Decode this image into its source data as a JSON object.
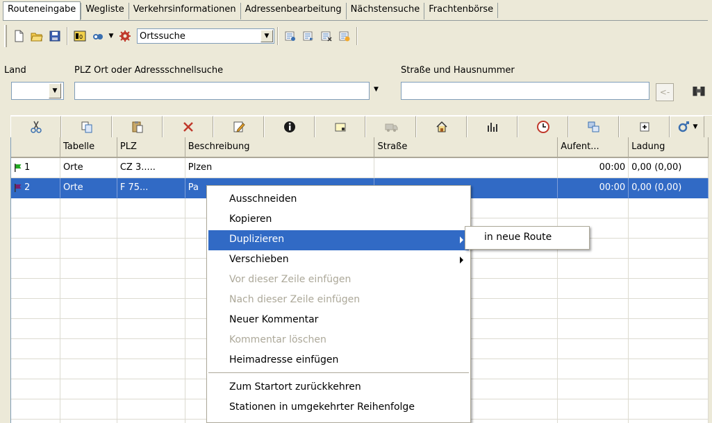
{
  "tabs": [
    "Routeneingabe",
    "Wegliste",
    "Verkehrsinformationen",
    "Adressenbearbeitung",
    "Nächstensuche",
    "Frachtenbörse"
  ],
  "toolbar": {
    "search_mode_value": "Ortssuche",
    "icons": [
      "new-document-icon",
      "open-folder-icon",
      "save-icon",
      "info-panel-icon",
      "binoculars-icon",
      "settings-gear-icon",
      "route-icon-1",
      "route-icon-2",
      "route-icon-3",
      "route-icon-4"
    ]
  },
  "address": {
    "land_label": "Land",
    "plz_label": "PLZ Ort oder Adressschnellsuche",
    "street_label": "Straße und Hausnummer",
    "land_value": "",
    "plz_value": "",
    "street_value": "",
    "back_button": "<-"
  },
  "grid_toolbar": {
    "icons": [
      "cut-icon",
      "copy-icon",
      "paste-icon",
      "delete-icon",
      "edit-icon",
      "info-icon",
      "note-icon",
      "truck-icon",
      "home-icon",
      "chart-icon",
      "clock-icon",
      "swap-icon",
      "add-icon",
      "gender-icon"
    ]
  },
  "grid": {
    "headers": [
      "",
      "Tabelle",
      "PLZ",
      "Beschreibung",
      "Straße",
      "Aufent...",
      "Ladung"
    ],
    "rows": [
      {
        "num": "1",
        "flag_color": "#22aa22",
        "tabelle": "Orte",
        "plz": "CZ 3.....",
        "beschreibung": "Plzen",
        "strasse": "",
        "aufent": "00:00",
        "ladung": "0,00 (0,00)"
      },
      {
        "num": "2",
        "flag_color": "#7a1f6e",
        "tabelle": "Orte",
        "plz": "F 75...",
        "beschreibung": "Pa",
        "strasse": "",
        "aufent": "00:00",
        "ladung": "0,00 (0,00)"
      }
    ]
  },
  "context_menu": {
    "items": [
      {
        "label": "Ausschneiden",
        "state": "normal"
      },
      {
        "label": "Kopieren",
        "state": "normal"
      },
      {
        "label": "Duplizieren",
        "state": "highlighted",
        "submenu": true
      },
      {
        "label": "Verschieben",
        "state": "normal",
        "submenu": true
      },
      {
        "label": "Vor dieser Zeile einfügen",
        "state": "disabled"
      },
      {
        "label": "Nach dieser Zeile einfügen",
        "state": "disabled"
      },
      {
        "label": "Neuer Kommentar",
        "state": "normal"
      },
      {
        "label": "Kommentar löschen",
        "state": "disabled"
      },
      {
        "label": "Heimadresse einfügen",
        "state": "normal"
      },
      {
        "label": "Zum Startort zurückkehren",
        "state": "normal"
      },
      {
        "label": "Stationen in umgekehrter Reihenfolge",
        "state": "normal"
      }
    ],
    "submenu_item": "in neue Route"
  },
  "colors": {
    "selection": "#316ac5",
    "window_bg": "#ece9d8",
    "disabled_text": "#aca899"
  }
}
